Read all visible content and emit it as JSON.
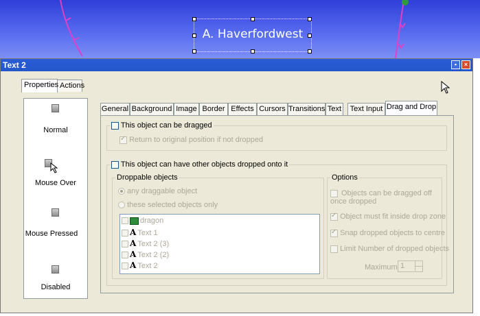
{
  "canvas": {
    "title_text": "A. Haverfordwest"
  },
  "dialog": {
    "title": "Text 2",
    "left_tabs": [
      "Properties",
      "Actions"
    ],
    "states": [
      {
        "label": "Normal",
        "icon": "button-state-icon"
      },
      {
        "label": "Mouse Over",
        "icon": "button-state-cursor-icon"
      },
      {
        "label": "Mouse Pressed",
        "icon": "button-state-icon"
      },
      {
        "label": "Disabled",
        "icon": "button-state-icon"
      }
    ],
    "tabs": [
      "General",
      "Background",
      "Image",
      "Border",
      "Effects",
      "Cursors",
      "Transitions",
      "Text",
      "Text Input",
      "Drag and Drop"
    ],
    "active_tab": "Drag and Drop",
    "drag": {
      "can_be_dragged_label": "This object can be dragged",
      "return_label": "Return to original position if not dropped"
    },
    "drop": {
      "can_have_dropped_label": "This object can have other objects dropped onto it",
      "droppable_legend": "Droppable objects",
      "any_label": "any draggable object",
      "selected_label": "these selected objects only",
      "objects": [
        {
          "name": "dragon",
          "icon": "picture-icon"
        },
        {
          "name": "Text 1",
          "icon": "text-object-icon"
        },
        {
          "name": "Text 2 (3)",
          "icon": "text-object-icon"
        },
        {
          "name": "Text 2 (2)",
          "icon": "text-object-icon"
        },
        {
          "name": "Text 2",
          "icon": "text-object-icon"
        }
      ],
      "options_legend": "Options",
      "opt_drag_off": "Objects can be dragged off once dropped",
      "opt_fit": "Object must fit inside drop zone",
      "opt_snap": "Snap dropped objects to centre",
      "opt_limit": "Limit Number of dropped objects",
      "maximum_label": "Maximum",
      "maximum_value": "1"
    }
  }
}
